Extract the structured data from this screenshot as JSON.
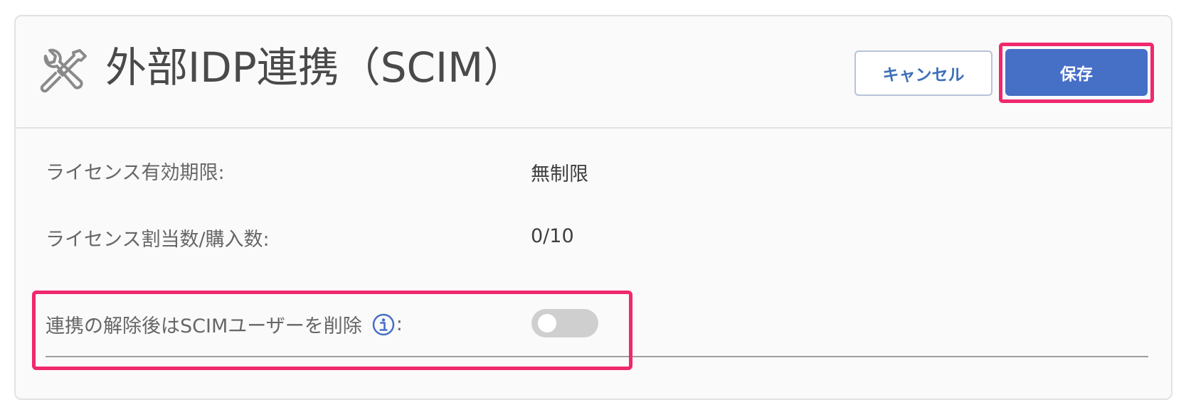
{
  "header": {
    "icon": "tools-icon",
    "title": "外部IDP連携（SCIM）",
    "cancel_label": "キャンセル",
    "save_label": "保存"
  },
  "fields": {
    "license_expiry": {
      "label": "ライセンス有効期限:",
      "value": "無制限"
    },
    "license_count": {
      "label": "ライセンス割当数/購入数:",
      "value": "0/10"
    },
    "delete_scim_users": {
      "label": "連携の解除後はSCIMユーザーを削除",
      "suffix": ":",
      "info_icon": "info-icon",
      "enabled": false
    }
  },
  "colors": {
    "primary": "#466fc6",
    "highlight": "#f0286e",
    "toggle_off": "#cfcfcf"
  }
}
